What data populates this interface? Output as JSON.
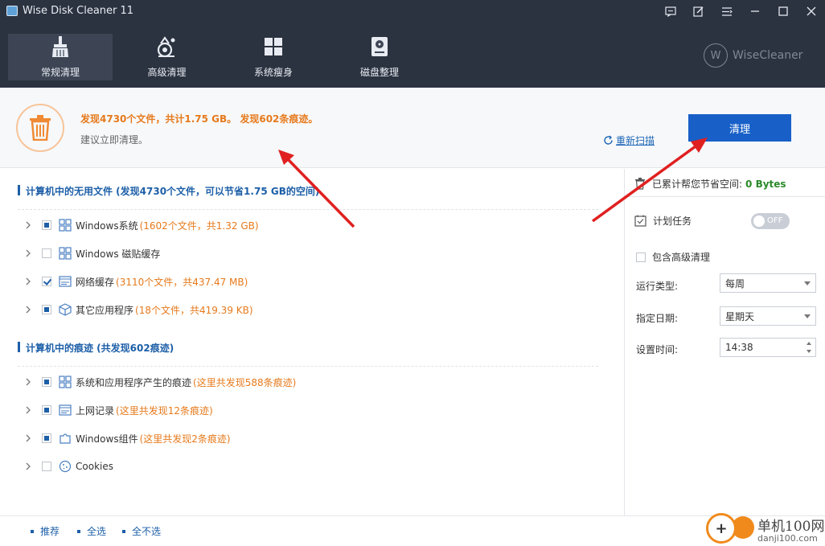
{
  "window": {
    "title": "Wise Disk Cleaner 11",
    "controls": [
      "feedback-icon",
      "edit-icon",
      "menu-icon",
      "minimize-icon",
      "maximize-icon",
      "close-icon"
    ]
  },
  "nav": {
    "tabs": [
      {
        "label": "常规清理",
        "icon": "broom-icon",
        "active": true
      },
      {
        "label": "高级清理",
        "icon": "advanced-clean-icon",
        "active": false
      },
      {
        "label": "系统瘦身",
        "icon": "windows-icon",
        "active": false
      },
      {
        "label": "磁盘整理",
        "icon": "disk-icon",
        "active": false
      }
    ],
    "brand": "WiseCleaner",
    "brand_logo": "W"
  },
  "summary": {
    "main_text": "发现4730个文件，共计1.75 GB。 发现602条痕迹。",
    "sub_text": "建议立即清理。",
    "rescan_label": "重新扫描",
    "clean_label": "清理"
  },
  "junk_section": {
    "title": "计算机中的无用文件 (发现4730个文件，可以节省1.75 GB的空间)",
    "items": [
      {
        "name": "Windows系统",
        "detail": "(1602个文件，共1.32 GB)",
        "check": "partial",
        "icon": "windows-grid-icon"
      },
      {
        "name": "Windows 磁贴缓存",
        "detail": "",
        "check": "none",
        "icon": "windows-grid-icon"
      },
      {
        "name": "网络缓存",
        "detail": "(3110个文件，共437.47 MB)",
        "check": "checked",
        "icon": "browser-window-icon"
      },
      {
        "name": "其它应用程序",
        "detail": "(18个文件，共419.39 KB)",
        "check": "partial",
        "icon": "cube-icon"
      }
    ]
  },
  "trace_section": {
    "title": "计算机中的痕迹 (共发现602痕迹)",
    "items": [
      {
        "name": "系统和应用程序产生的痕迹",
        "detail": "(这里共发现588条痕迹)",
        "check": "partial",
        "icon": "windows-grid-icon"
      },
      {
        "name": "上网记录",
        "detail": "(这里共发现12条痕迹)",
        "check": "partial",
        "icon": "browser-window-icon"
      },
      {
        "name": "Windows组件",
        "detail": "(这里共发现2条痕迹)",
        "check": "partial",
        "icon": "puzzle-icon"
      },
      {
        "name": "Cookies",
        "detail": "",
        "check": "none",
        "icon": "cookie-icon"
      }
    ]
  },
  "right_panel": {
    "saved_label": "已累计帮您节省空间:",
    "saved_value": "0 Bytes",
    "schedule_label": "计划任务",
    "toggle_label": "OFF",
    "advanced_label": "包含高级清理",
    "run_type_label": "运行类型:",
    "run_type_value": "每周",
    "date_label": "指定日期:",
    "date_value": "星期天",
    "time_label": "设置时间:",
    "time_value": "14:38"
  },
  "footer": {
    "recommend": "推荐",
    "select_all": "全选",
    "select_none": "全不选"
  },
  "watermark": {
    "title": "单机100网",
    "url": "danji100.com"
  },
  "colors": {
    "header_bg": "#2b3240",
    "accent_blue": "#1860c8",
    "orange": "#e67a1c",
    "green": "#2b8a2b",
    "arrow_red": "#e02020"
  }
}
